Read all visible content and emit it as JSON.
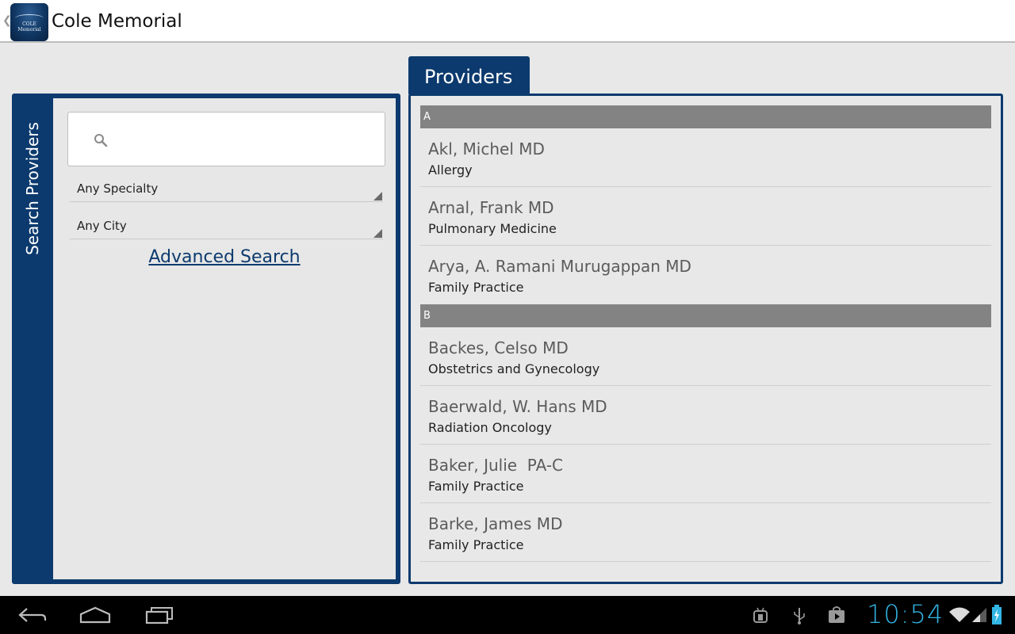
{
  "app": {
    "title": "Cole Memorial",
    "icon_text": "COLE Memorial"
  },
  "search": {
    "panel_label": "Search Providers",
    "query": "",
    "specialty": "Any Specialty",
    "city": "Any City",
    "advanced_link": "Advanced Search"
  },
  "providers": {
    "tab_label": "Providers",
    "sections": [
      {
        "letter": "A",
        "items": [
          {
            "name": "Akl, Michel MD",
            "specialty": "Allergy"
          },
          {
            "name": "Arnal, Frank MD",
            "specialty": "Pulmonary Medicine"
          },
          {
            "name": "Arya, A. Ramani Murugappan MD",
            "specialty": "Family Practice"
          }
        ]
      },
      {
        "letter": "B",
        "items": [
          {
            "name": "Backes, Celso MD",
            "specialty": "Obstetrics and Gynecology"
          },
          {
            "name": "Baerwald, W. Hans MD",
            "specialty": "Radiation Oncology"
          },
          {
            "name": "Baker, Julie  PA-C",
            "specialty": "Family Practice"
          },
          {
            "name": "Barke, James MD",
            "specialty": "Family Practice"
          }
        ]
      }
    ]
  },
  "system_bar": {
    "clock": "10:54",
    "icons": [
      "back-icon",
      "home-icon",
      "recent-apps-icon",
      "android-debug-icon",
      "usb-icon",
      "store-download-icon",
      "wifi-icon",
      "signal-icon",
      "battery-icon"
    ]
  },
  "colors": {
    "brand": "#0c3a6e",
    "section_header": "#838383",
    "clock": "#33b5e5"
  }
}
